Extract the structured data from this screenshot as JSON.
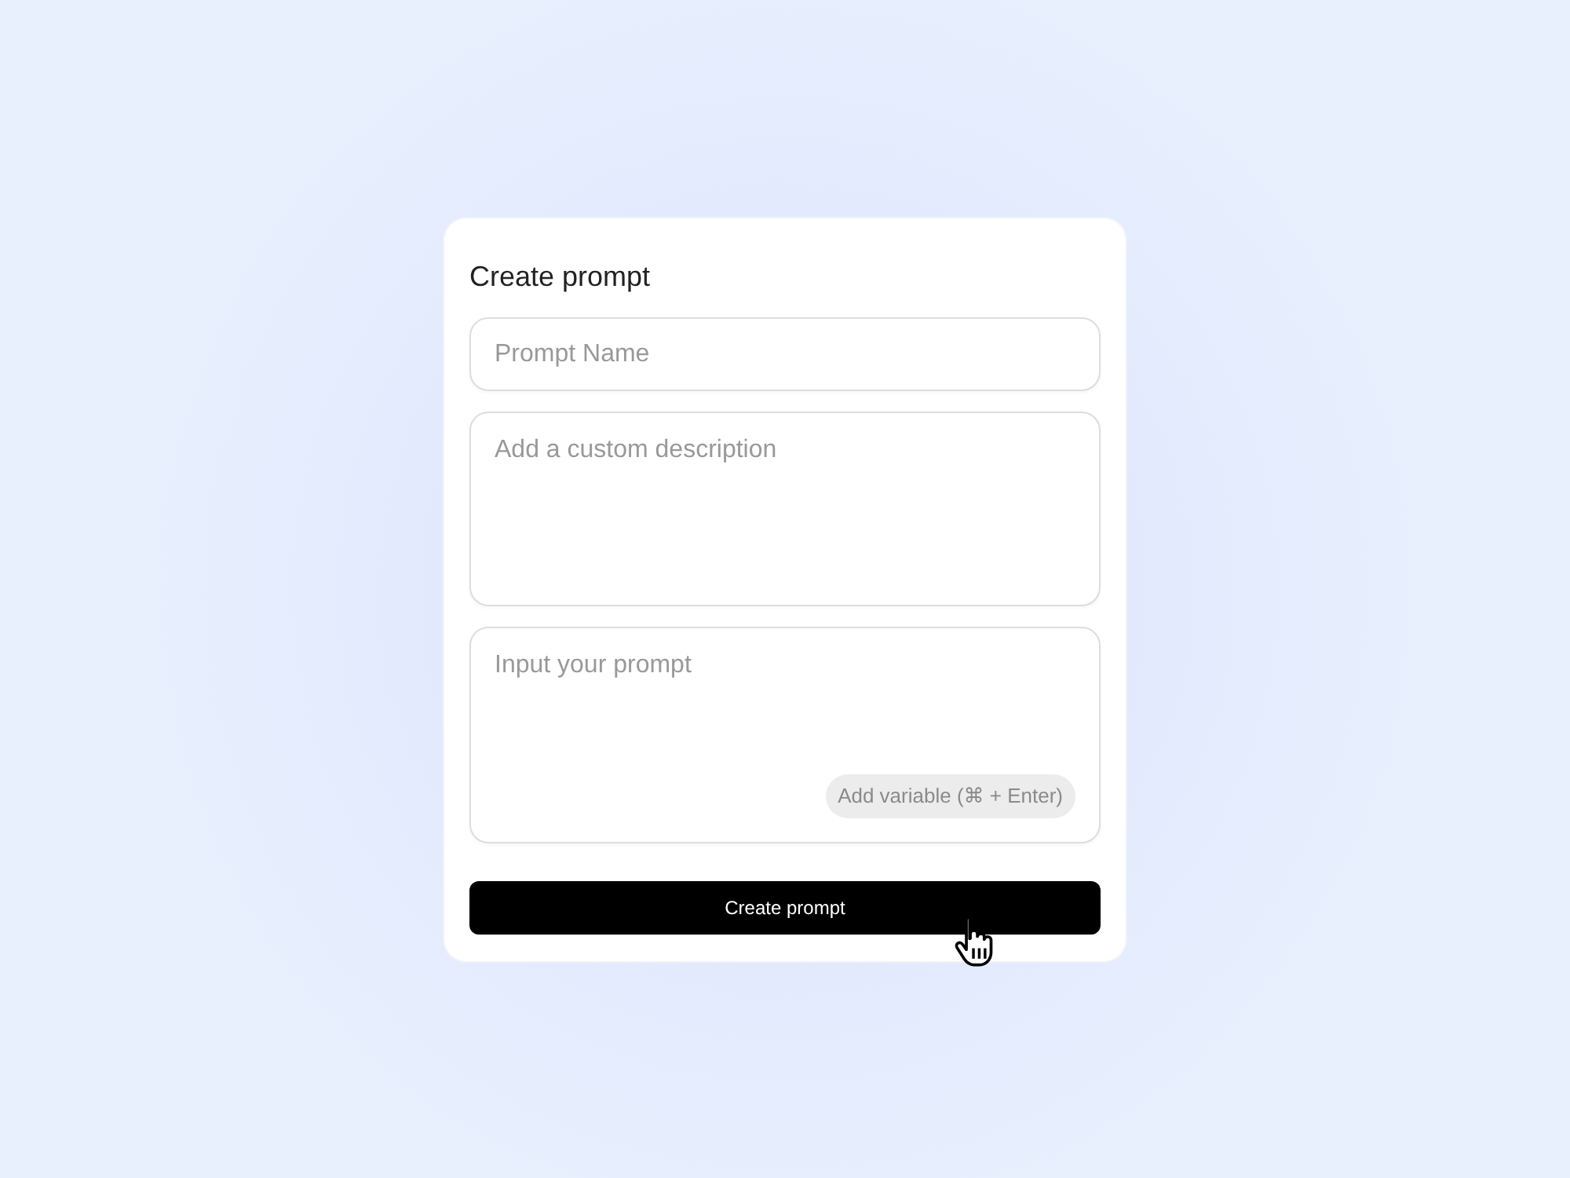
{
  "title": "Create prompt",
  "fields": [
    {
      "kind": "input",
      "placeholder": "Prompt Name"
    },
    {
      "kind": "textarea",
      "placeholder": "Add a custom description"
    },
    {
      "kind": "textarea",
      "placeholder": "Input your prompt",
      "chip": "Add variable (⌘ + Enter)"
    }
  ],
  "submit": "Create prompt"
}
